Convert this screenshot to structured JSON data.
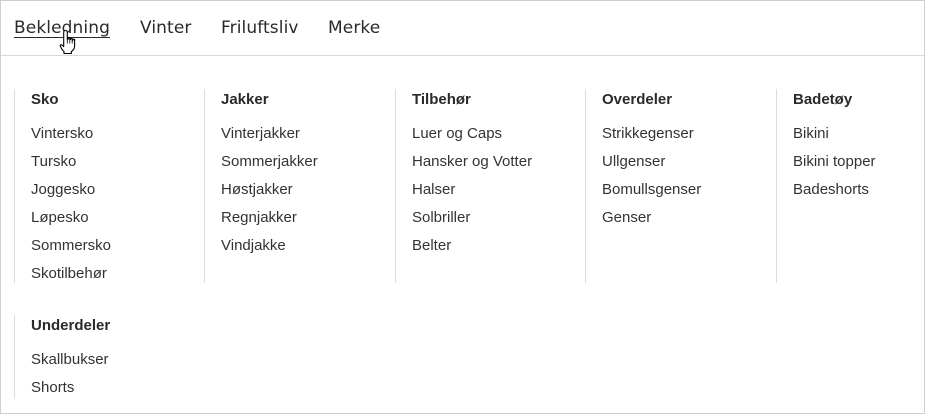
{
  "nav": {
    "items": [
      {
        "label": "Bekledning",
        "active": true
      },
      {
        "label": "Vinter"
      },
      {
        "label": "Friluftsliv"
      },
      {
        "label": "Merke"
      }
    ]
  },
  "menu": {
    "columns": [
      {
        "title": "Sko",
        "items": [
          "Vintersko",
          "Tursko",
          "Joggesko",
          "Løpesko",
          "Sommersko",
          "Skotilbehør"
        ]
      },
      {
        "title": "Jakker",
        "items": [
          "Vinterjakker",
          "Sommerjakker",
          "Høstjakker",
          "Regnjakker",
          "Vindjakke"
        ]
      },
      {
        "title": "Tilbehør",
        "items": [
          "Luer og Caps",
          "Hansker og Votter",
          "Halser",
          "Solbriller",
          "Belter"
        ]
      },
      {
        "title": "Overdeler",
        "items": [
          "Strikkegenser",
          "Ullgenser",
          "Bomullsgenser",
          "Genser"
        ]
      },
      {
        "title": "Badetøy",
        "items": [
          "Bikini",
          "Bikini topper",
          "Badeshorts"
        ]
      },
      {
        "title": "Underdeler",
        "items": [
          "Skallbukser",
          "Shorts"
        ]
      }
    ]
  },
  "icons": {
    "cursor": "hand-pointer-icon"
  }
}
